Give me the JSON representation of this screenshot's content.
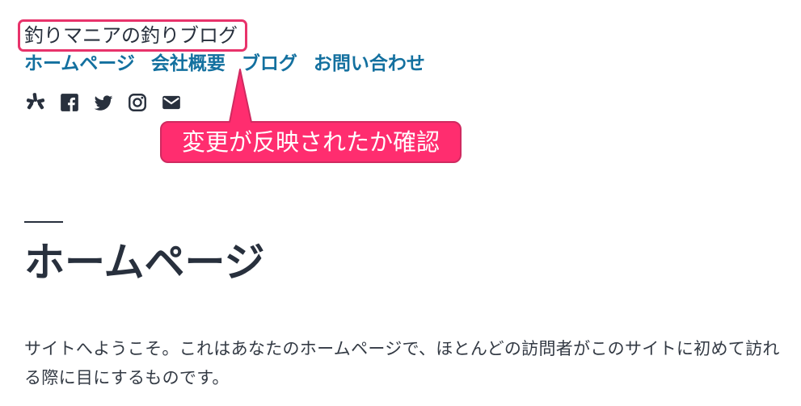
{
  "site": {
    "title": "釣りマニアの釣りブログ"
  },
  "nav": {
    "items": [
      "ホームページ",
      "会社概要",
      "ブログ",
      "お問い合わせ"
    ]
  },
  "social": {
    "icons": [
      "yelp-icon",
      "facebook-icon",
      "twitter-icon",
      "instagram-icon",
      "mail-icon"
    ]
  },
  "annotation": {
    "callout_text": "変更が反映されたか確認",
    "highlight_color": "#e8336b",
    "callout_color": "#ff2d6f"
  },
  "page": {
    "title": "ホームページ",
    "body": "サイトへようこそ。これはあなたのホームページで、ほとんどの訪問者がこのサイトに初めて訪れる際に目にするものです。"
  },
  "colors": {
    "link": "#13709f",
    "text": "#28303d",
    "background": "#ffffff"
  }
}
